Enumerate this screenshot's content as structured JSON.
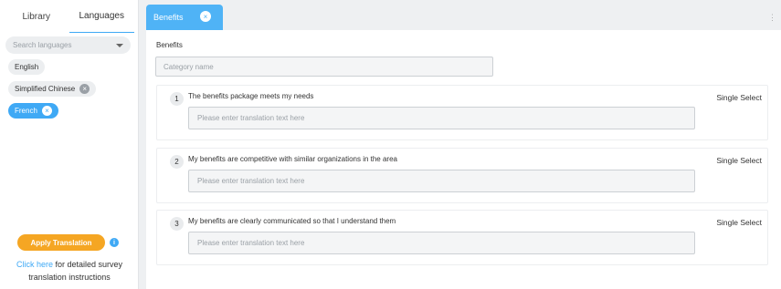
{
  "sidebar": {
    "tabs": [
      {
        "label": "Library"
      },
      {
        "label": "Languages"
      }
    ],
    "search_placeholder": "Search languages",
    "languages": [
      {
        "label": "English",
        "removable": false,
        "selected": false
      },
      {
        "label": "Simplified Chinese",
        "removable": true,
        "selected": false
      },
      {
        "label": "French",
        "removable": true,
        "selected": true
      }
    ],
    "apply_label": "Apply Translation",
    "info_icon": "i",
    "help_link": "Click here",
    "help_line1_rest": " for detailed survey",
    "help_line2": "translation instructions"
  },
  "main": {
    "tab_label": "Benefits",
    "tab_close": "×",
    "menu_dots": "⋮",
    "section_title": "Benefits",
    "category_placeholder": "Category name",
    "questions": [
      {
        "number": "1",
        "text": "The benefits package meets my needs",
        "type": "Single Select",
        "placeholder": "Please enter translation text here"
      },
      {
        "number": "2",
        "text": "My benefits are competitive with similar organizations in the area",
        "type": "Single Select",
        "placeholder": "Please enter translation text here"
      },
      {
        "number": "3",
        "text": "My benefits are clearly communicated so that I understand them",
        "type": "Single Select",
        "placeholder": "Please enter translation text here"
      }
    ]
  },
  "colors": {
    "accent": "#3fa9f5",
    "apply": "#f5a623"
  }
}
